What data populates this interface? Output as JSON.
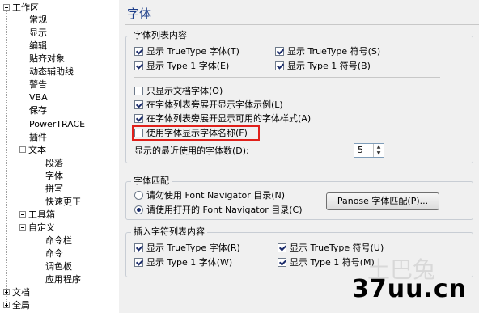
{
  "tree": {
    "workspace": "工作区",
    "items": [
      "常规",
      "显示",
      "编辑",
      "贴齐对象",
      "动态辅助线",
      "警告",
      "VBA",
      "保存",
      "PowerTRACE",
      "插件"
    ],
    "text": "文本",
    "text_children": [
      "段落",
      "字体",
      "拼写",
      "快速更正"
    ],
    "toolbox": "工具箱",
    "custom": "自定义",
    "custom_children": [
      "命令栏",
      "命令",
      "调色板",
      "应用程序"
    ],
    "document": "文档",
    "global": "全局"
  },
  "panel": {
    "title": "字体",
    "list_group": {
      "title": "字体列表内容",
      "truetype_font": "显示 TrueType 字体(T)",
      "truetype_symbol": "显示 TrueType 符号(S)",
      "type1_font": "显示 Type 1 字体(E)",
      "type1_symbol": "显示 Type 1 符号(B)",
      "doc_fonts_only": "只显示文档字体(O)",
      "show_sample": "在字体列表旁展开显示字体示例(L)",
      "show_styles": "在字体列表旁展开显示可用的字体样式(A)",
      "use_font_names": "使用字体显示字体名称(F)",
      "recent_label": "显示的最近使用的字体数(D):",
      "recent_value": "5"
    },
    "match_group": {
      "title": "字体匹配",
      "opt_no": "请勿使用 Font Navigator 目录(N)",
      "opt_yes": "请使用打开的 Font Navigator 目录(C)",
      "panose_button": "Panose 字体匹配(P)..."
    },
    "symbol_group": {
      "title": "插入字符列表内容",
      "truetype_font": "显示 TrueType 字体(R)",
      "truetype_symbol": "显示 TrueType 符号(U)",
      "type1_font": "显示 Type 1 字体(W)",
      "type1_symbol": "显示 Type 1 符号(M)"
    }
  },
  "watermark": {
    "small": "土巴兔",
    "domain": "37uu.cn"
  },
  "colors": {
    "heading": "#1d3e8a",
    "highlight_border": "#e0201a"
  }
}
